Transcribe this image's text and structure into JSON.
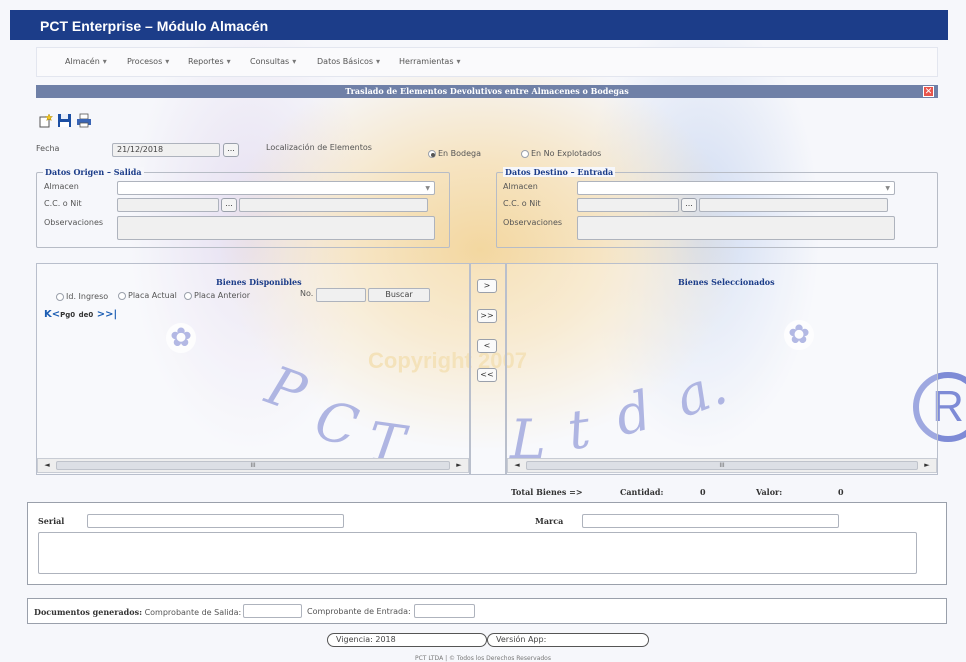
{
  "app": {
    "title": "PCT Enterprise – Módulo Almacén"
  },
  "menu": [
    {
      "label": "Almacén"
    },
    {
      "label": "Procesos"
    },
    {
      "label": "Reportes"
    },
    {
      "label": "Consultas"
    },
    {
      "label": "Datos Básicos"
    },
    {
      "label": "Herramientas"
    }
  ],
  "module": {
    "title": "Traslado de Elementos Devolutivos entre Almacenes o Bodegas",
    "close": "✕"
  },
  "toolbar": {
    "new_icon": "new-document-icon",
    "save_icon": "save-icon",
    "print_icon": "print-icon"
  },
  "form": {
    "fecha_label": "Fecha",
    "fecha_value": "21/12/2018",
    "dots": "...",
    "localizacion_label": "Localización de Elementos",
    "radio_bodega": "En Bodega",
    "radio_no_explotados": "En No Explotados"
  },
  "origen": {
    "legend": "Datos Origen – Salida",
    "almacen_label": "Almacen",
    "ccnit_label": "C.C. o Nit",
    "observaciones_label": "Observaciones"
  },
  "destino": {
    "legend": "Datos Destino – Entrada",
    "almacen_label": "Almacen",
    "ccnit_label": "C.C. o Nit",
    "observaciones_label": "Observaciones"
  },
  "disponibles": {
    "title": "Bienes Disponibles",
    "radio_ingreso": "Id. Ingreso",
    "radio_placa_actual": "Placa Actual",
    "radio_placa_anterior": "Placa Anterior",
    "no_label": "No.",
    "buscar": "Buscar",
    "pager_first": "K",
    "pager_prev": "<",
    "pager_pg": "Pg",
    "pager_page": "0",
    "pager_de": "de",
    "pager_total": "0",
    "pager_next": ">",
    "pager_last": ">|"
  },
  "seleccionados": {
    "title": "Bienes Seleccionados"
  },
  "move_buttons": {
    "one_right": ">",
    "all_right": ">>",
    "one_left": "<",
    "all_left": "<<"
  },
  "scroll": {
    "thumb": "III",
    "left": "◄",
    "right": "►"
  },
  "totals": {
    "label": "Total Bienes =>",
    "cantidad_label": "Cantidad:",
    "cantidad": "0",
    "valor_label": "Valor:",
    "valor": "0"
  },
  "detalle": {
    "serial_label": "Serial",
    "marca_label": "Marca"
  },
  "documentos": {
    "label": "Documentos generados:",
    "salida_label": "Comprobante de Salida:",
    "entrada_label": "Comprobante de Entrada:"
  },
  "status": {
    "vigencia": "Vigencia: 2018",
    "version": "Versión App:"
  },
  "footer": {
    "text": "PCT LTDA | © Todos los Derechos Reservados"
  },
  "watermark": {
    "copyright": "Copyright 2007",
    "p": "P",
    "c": "C",
    "t": "T",
    "l": "L",
    "t2": "t",
    "d": "d",
    "a": "a.",
    "r": "R",
    "star": "✿"
  },
  "colors": {
    "header": "#1c3d89",
    "modbar": "#6f80a7",
    "accent": "#1c3d89",
    "close": "#e8544b"
  }
}
